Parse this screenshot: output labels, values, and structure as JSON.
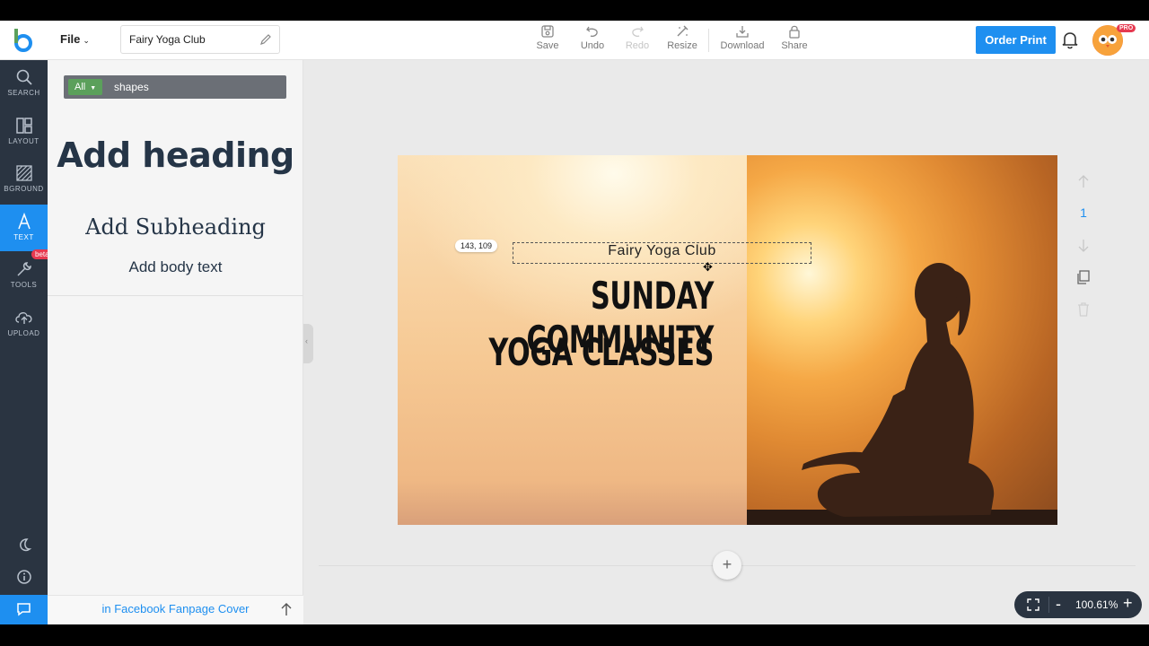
{
  "header": {
    "file_label": "File",
    "document_title": "Fairy Yoga Club",
    "tools": [
      {
        "label": "Save",
        "icon": "save-icon"
      },
      {
        "label": "Undo",
        "icon": "undo-icon"
      },
      {
        "label": "Redo",
        "icon": "redo-icon"
      },
      {
        "label": "Resize",
        "icon": "resize-icon"
      },
      {
        "label": "Download",
        "icon": "download-icon"
      },
      {
        "label": "Share",
        "icon": "share-icon"
      }
    ],
    "order_print_label": "Order Print",
    "pro_badge": "PRO"
  },
  "leftnav": {
    "items": [
      {
        "label": "SEARCH",
        "icon": "search-icon"
      },
      {
        "label": "LAYOUT",
        "icon": "layout-icon"
      },
      {
        "label": "BGROUND",
        "icon": "background-icon"
      },
      {
        "label": "TEXT",
        "icon": "text-icon"
      },
      {
        "label": "TOOLS",
        "icon": "tools-icon"
      },
      {
        "label": "UPLOAD",
        "icon": "upload-icon"
      }
    ],
    "beta_badge": "beta"
  },
  "panel": {
    "filter_chip": "All",
    "search_value": "shapes",
    "add_heading": "Add heading",
    "add_subheading": "Add Subheading",
    "add_body": "Add body text",
    "footer_link": "in Facebook Fanpage Cover"
  },
  "canvas": {
    "coord_tag": "143, 109",
    "brand_text": "Fairy Yoga Club",
    "headline_line1": "SUNDAY COMMUNITY",
    "headline_line2": "YOGA CLASSES",
    "page_number": "1",
    "add_page": "+"
  },
  "zoom": {
    "value": "100.61%",
    "minus": "-",
    "plus": "+"
  },
  "colors": {
    "accent": "#1e8ff0",
    "nav_bg": "#2a3441",
    "badge_red": "#e63950"
  }
}
